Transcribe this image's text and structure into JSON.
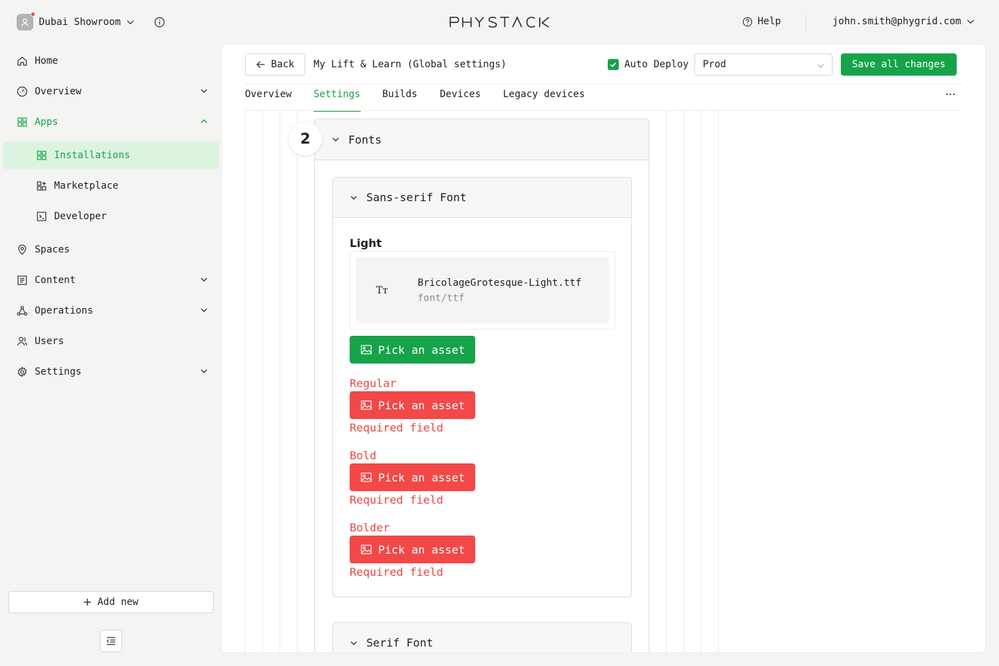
{
  "workspace": {
    "name": "Dubai Showroom"
  },
  "brand": {
    "logo_text": "PHYSTACK",
    "accent": "#16a34a",
    "error": "#ef4444"
  },
  "topbar": {
    "help_label": "Help",
    "user_email": "john.smith@phygrid.com"
  },
  "sidebar": {
    "items": [
      {
        "label": "Home",
        "icon": "home-icon"
      },
      {
        "label": "Overview",
        "icon": "dashboard-icon"
      },
      {
        "label": "Apps",
        "icon": "apps-grid-icon"
      },
      {
        "label": "Installations",
        "icon": "apps-grid-icon"
      },
      {
        "label": "Marketplace",
        "icon": "marketplace-icon"
      },
      {
        "label": "Developer",
        "icon": "terminal-icon"
      },
      {
        "label": "Spaces",
        "icon": "location-pin-icon"
      },
      {
        "label": "Content",
        "icon": "content-icon"
      },
      {
        "label": "Operations",
        "icon": "operations-icon"
      },
      {
        "label": "Users",
        "icon": "users-icon"
      },
      {
        "label": "Settings",
        "icon": "gear-icon"
      }
    ],
    "add_new_label": "Add new"
  },
  "header": {
    "back_label": "Back",
    "title": "My Lift & Learn (Global settings)",
    "auto_deploy_label": "Auto Deploy",
    "auto_deploy_checked": true,
    "environment": "Prod",
    "save_label": "Save all changes"
  },
  "tabs": [
    {
      "label": "Overview"
    },
    {
      "label": "Settings",
      "active": true
    },
    {
      "label": "Builds"
    },
    {
      "label": "Devices"
    },
    {
      "label": "Legacy devices"
    }
  ],
  "editor": {
    "step_number": "2",
    "section_title": "Fonts",
    "sans_serif": {
      "title": "Sans-serif Font",
      "light": {
        "label": "Light",
        "file_name": "BricolageGrotesque-Light.ttf",
        "file_type": "font/ttf",
        "file_icon": "Tт"
      },
      "regular": {
        "label": "Regular",
        "error": "Required field"
      },
      "bold": {
        "label": "Bold",
        "error": "Required field"
      },
      "bolder": {
        "label": "Bolder",
        "error": "Required field"
      },
      "pick_label": "Pick an asset"
    },
    "serif": {
      "title": "Serif Font"
    }
  }
}
